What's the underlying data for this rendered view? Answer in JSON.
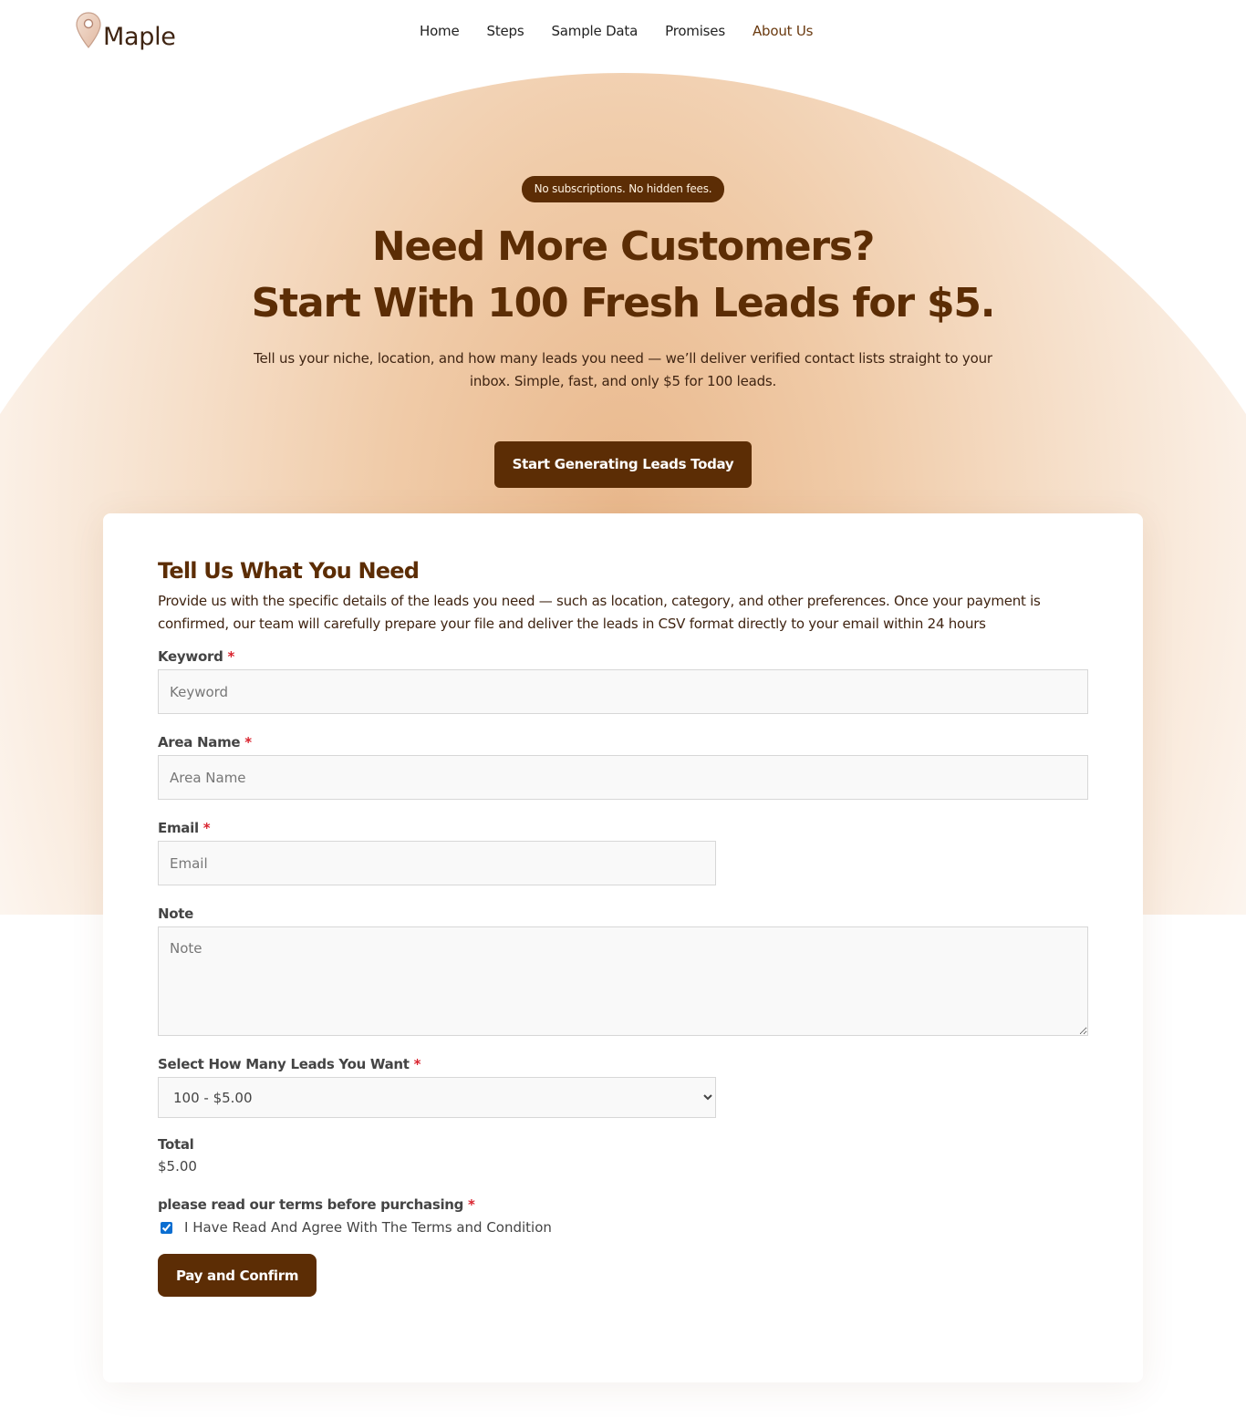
{
  "brand": {
    "name": "Maple",
    "accent": "#5c2d05"
  },
  "nav": {
    "items": [
      "Home",
      "Steps",
      "Sample Data",
      "Promises",
      "About Us"
    ]
  },
  "hero": {
    "badge": "No subscriptions. No hidden fees.",
    "title_line1": "Need More Customers?",
    "title_line2": "Start With 100 Fresh Leads for $5.",
    "subtitle": "Tell us your niche, location, and how many leads you need — we’ll deliver verified contact lists straight to your inbox. Simple, fast, and only $5 for 100 leads.",
    "cta_label": "Start Generating Leads Today"
  },
  "form": {
    "title": "Tell Us What You Need",
    "description": "Provide us with the specific details of the leads you need — such as location, category, and other preferences. Once your payment is confirmed, our team will carefully prepare your file and deliver the leads in CSV format directly to your email within 24 hours",
    "required_mark": "*",
    "keyword": {
      "label": "Keyword",
      "placeholder": "Keyword",
      "value": ""
    },
    "area": {
      "label": "Area Name",
      "placeholder": "Area Name",
      "value": ""
    },
    "email": {
      "label": "Email",
      "placeholder": "Email",
      "value": ""
    },
    "note": {
      "label": "Note",
      "placeholder": "Note",
      "value": ""
    },
    "leads": {
      "label": "Select How Many Leads You Want",
      "selected": "100 - $5.00"
    },
    "total": {
      "label": "Total",
      "value": "$5.00"
    },
    "terms": {
      "label": "please read our terms before purchasing",
      "checkbox_label": "I Have Read And Agree With The Terms and Condition",
      "checked": true
    },
    "submit_label": "Pay and Confirm"
  }
}
